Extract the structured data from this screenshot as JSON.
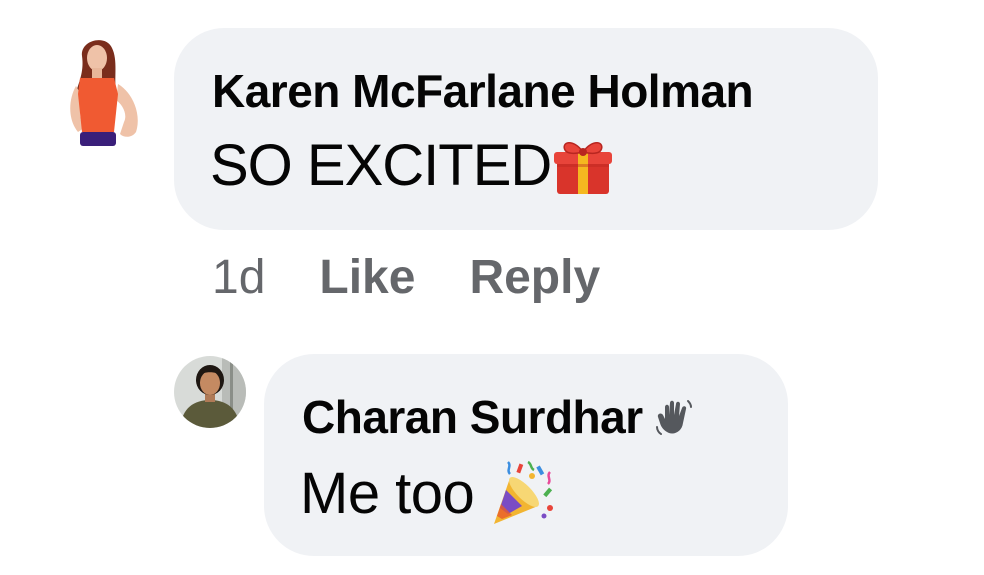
{
  "comments": [
    {
      "author": "Karen McFarlane Holman",
      "text": "SO EXCITED",
      "emoji": "gift-icon",
      "time": "1d",
      "like_label": "Like",
      "reply_label": "Reply"
    },
    {
      "author": "Charan Surdhar",
      "author_badge": "waving-hand-icon",
      "text": "Me too",
      "emoji": "party-popper-icon"
    }
  ],
  "colors": {
    "bubble": "#f0f2f5",
    "text": "#050505",
    "meta": "#65676b"
  }
}
